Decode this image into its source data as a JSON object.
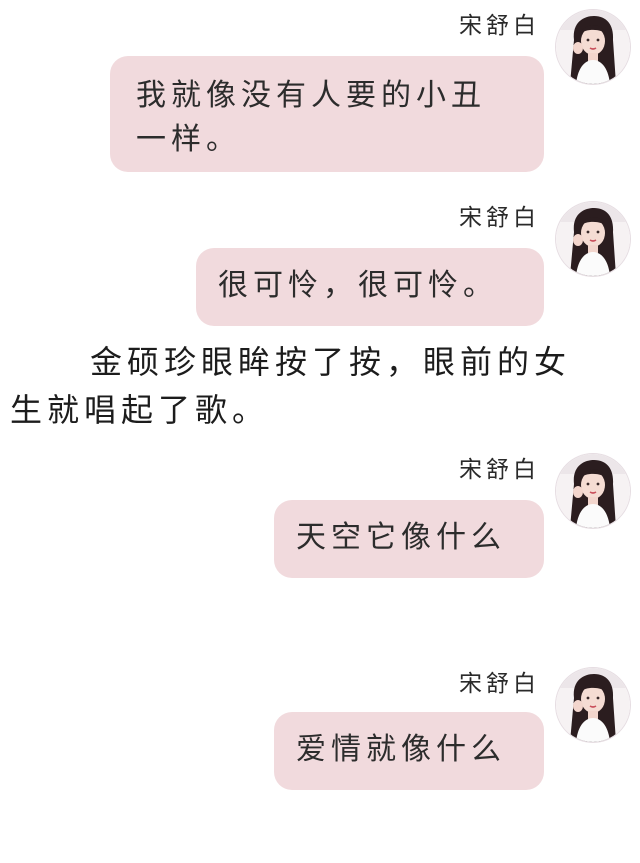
{
  "messages": [
    {
      "sender": "宋舒白",
      "lines": [
        "我就像没有人要的小丑",
        "一样。"
      ]
    },
    {
      "sender": "宋舒白",
      "lines": [
        "很可怜，很可怜。"
      ]
    },
    {
      "sender": "宋舒白",
      "lines": [
        "天空它像什么"
      ]
    },
    {
      "sender": "宋舒白",
      "lines": [
        "爱情就像什么"
      ]
    }
  ],
  "narration": {
    "line1": "金硕珍眼眸按了按，眼前的女",
    "line2": "生就唱起了歌。"
  },
  "colors": {
    "bubble": "#f1dadd",
    "background": "#ffffff"
  },
  "icons": {
    "avatar": "profile-photo-girl-icon"
  }
}
